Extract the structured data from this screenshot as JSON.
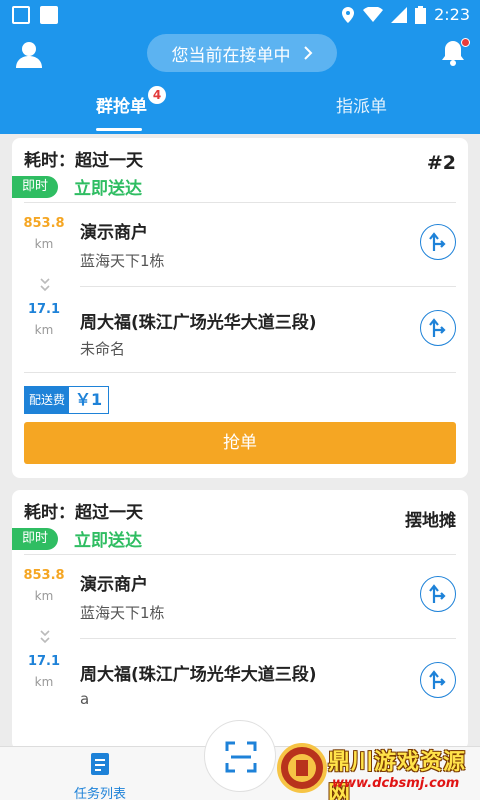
{
  "status_bar": {
    "time": "2:23"
  },
  "header": {
    "status_pill": "您当前在接单中",
    "tabs": [
      {
        "label": "群抢单",
        "badge": "4"
      },
      {
        "label": "指派单"
      }
    ]
  },
  "orders": [
    {
      "time_label": "耗时：超过一天",
      "tag": "#2",
      "instant_badge": "即时",
      "instant_text": "立即送达",
      "pickup": {
        "distance": "853.8",
        "unit": "km",
        "name": "演示商户",
        "address": "蓝海天下1栋"
      },
      "dropoff": {
        "distance": "17.1",
        "unit": "km",
        "name": "周大福(珠江广场光华大道三段)",
        "address": "未命名"
      },
      "fee_label": "配送费",
      "fee_value": "￥1",
      "grab_label": "抢单"
    },
    {
      "time_label": "耗时：超过一天",
      "tag": "摆地摊",
      "instant_badge": "即时",
      "instant_text": "立即送达",
      "pickup": {
        "distance": "853.8",
        "unit": "km",
        "name": "演示商户",
        "address": "蓝海天下1栋"
      },
      "dropoff": {
        "distance": "17.1",
        "unit": "km",
        "name": "周大福(珠江广场光华大道三段)",
        "address": "a"
      }
    }
  ],
  "bottom_nav": {
    "tasks_label": "任务列表"
  },
  "watermark": {
    "title": "鼎川游戏资源网",
    "url": "www.dcbsmj.com"
  },
  "colors": {
    "primary": "#1e96ec",
    "accent_orange": "#f5a623",
    "green": "#2fbd62",
    "link_blue": "#1e82d8"
  }
}
